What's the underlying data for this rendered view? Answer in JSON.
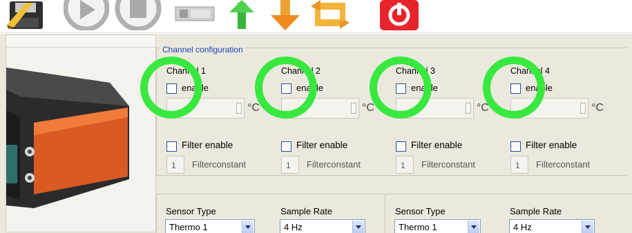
{
  "toolbar": {
    "icons": [
      "save-icon",
      "play-icon",
      "stop-icon",
      "device-icon",
      "upload-icon",
      "download-icon",
      "swap-icon",
      "power-icon"
    ]
  },
  "group": {
    "legend": "Channel configuration"
  },
  "channels": [
    {
      "title": "Channel 1",
      "enable": "enable",
      "unit": "°C",
      "filter": "Filter enable",
      "fc_value": "1",
      "fc_label": "Filterconstant"
    },
    {
      "title": "Channel 2",
      "enable": "enable",
      "unit": "°C",
      "filter": "Filter enable",
      "fc_value": "1",
      "fc_label": "Filterconstant"
    },
    {
      "title": "Channel 3",
      "enable": "enable",
      "unit": "°C",
      "filter": "Filter enable",
      "fc_value": "1",
      "fc_label": "Filterconstant"
    },
    {
      "title": "Channel 4",
      "enable": "enable",
      "unit": "°C",
      "filter": "Filter enable",
      "fc_value": "1",
      "fc_label": "Filterconstant"
    }
  ],
  "lower": [
    {
      "sensor_label": "Sensor Type",
      "sensor_value": "Thermo 1",
      "rate_label": "Sample Rate",
      "rate_value": "4 Hz"
    },
    {
      "sensor_label": "Sensor Type",
      "sensor_value": "Thermo 1",
      "rate_label": "Sample Rate",
      "rate_value": "4 Hz"
    }
  ],
  "colors": {
    "highlight": "#39e83f",
    "legend": "#1a3fb5",
    "panel": "#ebe9de"
  }
}
